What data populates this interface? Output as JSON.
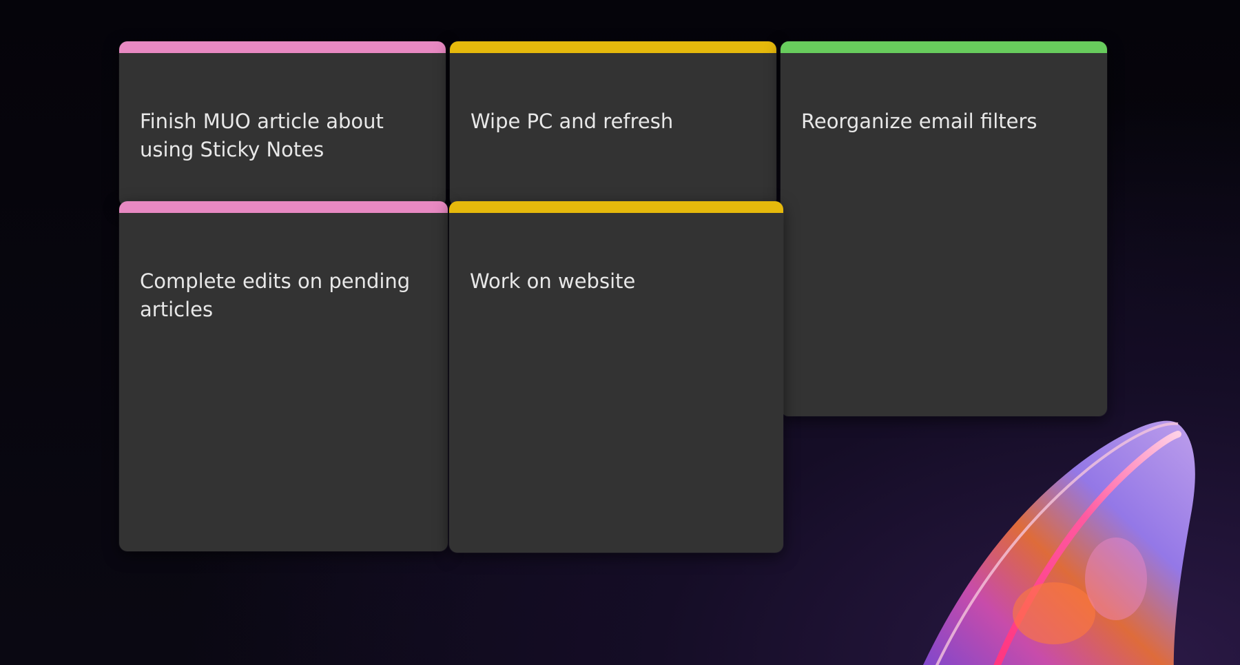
{
  "notes": [
    {
      "text": "Finish MUO article about\nusing Sticky Notes",
      "color": "#e889c2"
    },
    {
      "text": "Wipe PC and refresh",
      "color": "#e6b90c"
    },
    {
      "text": "Reorganize email filters",
      "color": "#68cc5d"
    },
    {
      "text": "Complete edits on pending\narticles",
      "color": "#e889c2"
    },
    {
      "text": "Work on website",
      "color": "#e6b90c"
    }
  ]
}
